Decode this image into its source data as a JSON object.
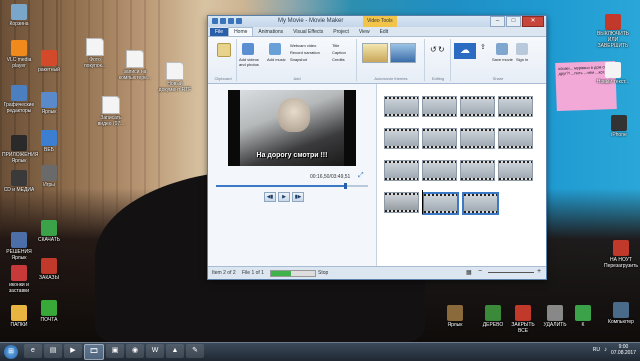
{
  "desktop": {
    "left_icons": [
      {
        "label": "Корзина",
        "icon": "recycle-bin-icon",
        "color": "#7aa7c9"
      },
      {
        "label": "VLC media player",
        "icon": "vlc-icon",
        "color": "#f08a1c"
      },
      {
        "label": "Графические редакторы",
        "icon": "paint-icon",
        "color": "#4b7fc0"
      },
      {
        "label": "ПРИЛОЖЕНИЯ Ярлык",
        "icon": "apps-folder-icon",
        "color": "#2a2a2a"
      },
      {
        "label": "CD и МЕДИА",
        "icon": "disc-icon",
        "color": "#3a3a3a"
      },
      {
        "label": "РЕШЕНИЯ Ярлык",
        "icon": "solutions-icon",
        "color": "#4d6fa8"
      },
      {
        "label": "иконки и заставки",
        "icon": "icons-folder-icon",
        "color": "#c83a3a"
      },
      {
        "label": "ПАПКИ",
        "icon": "folder-icon",
        "color": "#e8b640"
      }
    ],
    "col2_icons": [
      {
        "label": "ракетный",
        "icon": "rocket-icon",
        "color": "#d24a2a"
      },
      {
        "label": "Ярлык",
        "icon": "shortcut-icon",
        "color": "#5a8ac9"
      },
      {
        "label": "ВЕБ",
        "icon": "web-icon",
        "color": "#3c7fd1"
      },
      {
        "label": "Игры",
        "icon": "games-icon",
        "color": "#6a6a6a"
      },
      {
        "label": "СКАЧАТЬ",
        "icon": "download-icon",
        "color": "#3ba24a"
      },
      {
        "label": "ЗАКАЗЫ",
        "icon": "orders-icon",
        "color": "#c0392b"
      },
      {
        "label": "ПОЧТА",
        "icon": "play-icon",
        "color": "#38a838"
      }
    ],
    "doc_icons": [
      {
        "label": "Фото покупок...",
        "icon": "document-icon"
      },
      {
        "label": "записи на компьютере...",
        "icon": "document-icon"
      },
      {
        "label": "Новый документ RTF",
        "icon": "document-icon"
      },
      {
        "label": "Записать видео (07...",
        "icon": "document-icon"
      }
    ],
    "right_icons": [
      {
        "label": "ВЫКЛЮЧИТЬ ИЛИ ЗАВЕРШИТЬ",
        "icon": "shutdown-icon",
        "color": "#c0392b"
      },
      {
        "label": "Новый текст...",
        "icon": "text-doc-icon",
        "color": "#f4f4f4"
      },
      {
        "label": "iPhone",
        "icon": "phone-icon",
        "color": "#333"
      },
      {
        "label": "НА НОУТ Перезагрузить",
        "icon": "restart-icon",
        "color": "#c0392b"
      },
      {
        "label": "Компьютер",
        "icon": "computer-icon",
        "color": "#4a6a8a"
      }
    ],
    "bottom_icons": [
      {
        "label": "Ярлык",
        "icon": "stamp-icon",
        "color": "#8a6a3a"
      },
      {
        "label": "ДЕРЕВО",
        "icon": "tree-icon",
        "color": "#3a8a3a"
      },
      {
        "label": "ЗАКРЫТЬ ВСЕ",
        "icon": "close-all-icon",
        "color": "#c0392b"
      },
      {
        "label": "УДАЛИТЬ",
        "icon": "trash-icon",
        "color": "#888"
      },
      {
        "label": "К",
        "icon": "k-icon",
        "color": "#3ba24a"
      }
    ],
    "sticky_note": "кошки... муравьи в дом от... друг?! ...пить ...чем ...кот.."
  },
  "window": {
    "title": "My Movie - Movie Maker",
    "context_tab": "Video Tools",
    "tabs": [
      "File",
      "Home",
      "Animations",
      "Visual Effects",
      "Project",
      "View",
      "Edit"
    ],
    "active_tab": "Home",
    "ribbon": {
      "groups": [
        "Clipboard",
        "Add",
        "Automovie themes",
        "Editing",
        "Share"
      ],
      "add_videos_label": "Add videos and photos",
      "add_music_label": "Add music",
      "webcam_label": "Webcam video",
      "narration_label": "Record narration",
      "snapshot_label": "Snapshot",
      "title_label": "Title",
      "caption_label": "Caption",
      "credits_label": "Credits",
      "rotate_label": "Rotate",
      "onedrive_label": "OneDrive",
      "save_label": "Save movie",
      "signin_label": "Sign in"
    },
    "preview": {
      "caption": "На дорогу смотри !!!",
      "timecode": "00:16,50/03:49,51"
    },
    "seek_fraction": 0.85,
    "status": {
      "item": "Item 2 of 2",
      "file": "File 1 of 1",
      "stop": "Stop"
    },
    "progress_fraction": 0.45
  },
  "taskbar": {
    "items": [
      "ie-icon",
      "explorer-icon",
      "media-icon",
      "movie-maker-icon",
      "photo-icon",
      "chrome-icon",
      "word-icon",
      "vlc-icon",
      "paint-icon"
    ],
    "lang": "RU",
    "time": "9:00",
    "date": "07.08.2017"
  }
}
